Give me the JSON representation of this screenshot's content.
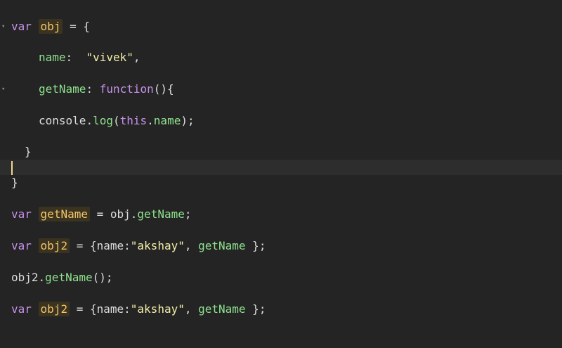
{
  "editor": {
    "fold_marker": "▾",
    "lines": [
      {
        "kw": "var",
        "var": "obj",
        "rest": " = {"
      },
      {
        "prop": "name",
        "colon": ":  ",
        "str": "\"vivek\"",
        "rest": ","
      },
      {
        "prop": "getName",
        "colon": ": ",
        "kw": "function",
        "rest": "(){"
      },
      {
        "obj": "console",
        "dot": ".",
        "method": "log",
        "open": "(",
        "this": "this",
        "dot2": ".",
        "prop": "name",
        "close": ");"
      },
      {
        "text": "}"
      },
      {
        "text": ""
      },
      {
        "text": "}"
      },
      {
        "kw": "var",
        "var": "getName",
        "mid": " = obj.",
        "prop": "getName",
        "rest": ";"
      },
      {
        "kw": "var",
        "var": "obj2",
        "mid": " = {",
        "key": "name",
        "colon": ":",
        "str": "\"akshay\"",
        "comma": ", ",
        "prop": "getName",
        "rest": " };"
      },
      {
        "obj": "obj2",
        "dot": ".",
        "prop": "getName",
        "rest": "();"
      },
      {
        "kw": "var",
        "var": "obj2",
        "mid": " = {",
        "key": "name",
        "colon": ":",
        "str": "\"akshay\"",
        "comma": ", ",
        "prop": "getName",
        "rest": " };"
      }
    ]
  }
}
